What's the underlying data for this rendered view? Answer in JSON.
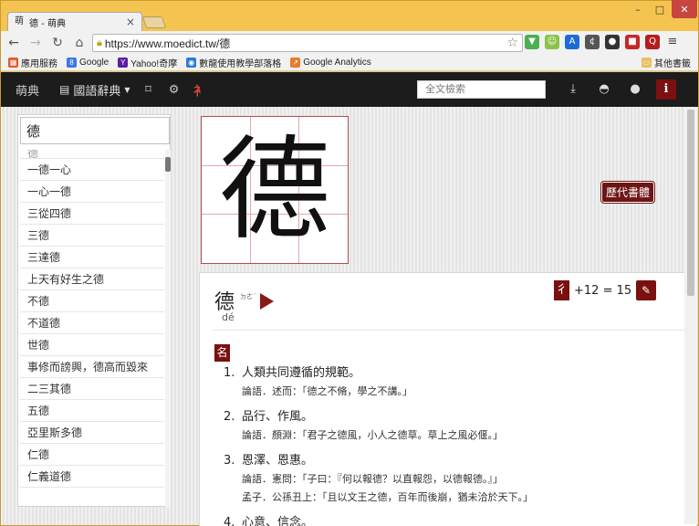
{
  "browser": {
    "tab_title": "德 - 萌典",
    "tab_favicon": "萌",
    "tab_close": "×",
    "url": "https://www.moedict.tw/德",
    "window_controls": {
      "minimize": "–",
      "maximize": "□",
      "close": "✕"
    }
  },
  "bookmarks": [
    {
      "label": "應用服務",
      "icon": "apps-grid-icon",
      "color": "#e05a2a"
    },
    {
      "label": "Google",
      "icon": "google-icon",
      "color": "#3b78e7"
    },
    {
      "label": "Yahoo!奇摩",
      "icon": "yahoo-icon",
      "color": "#5a1fa0"
    },
    {
      "label": "數龍使用教學部落格",
      "icon": "blog-icon",
      "color": "#2a7ad6"
    },
    {
      "label": "Google Analytics",
      "icon": "analytics-icon",
      "color": "#e87b2a"
    }
  ],
  "bookmarks_other": "其他書籤",
  "site": {
    "logo": "萌典",
    "dict_label": "國語辭典",
    "search_placeholder": "全文檢索"
  },
  "sidebar": {
    "query": "德",
    "partial_item": "德",
    "items": [
      "一德一心",
      "一心一德",
      "三從四德",
      "三德",
      "三達德",
      "上天有好生之德",
      "不德",
      "不道德",
      "世德",
      "事修而謗興，德高而毀來",
      "二三其德",
      "五德",
      "亞里斯多德",
      "仁德",
      "仁義道德"
    ]
  },
  "entry": {
    "character": "德",
    "history_button": "歷代書體",
    "headword": "德",
    "bopomofo": "ㄉㄜˊ",
    "pinyin": "dé",
    "radical": "彳",
    "strokes": "+12 = 15",
    "part_of_speech": "名",
    "definitions": [
      {
        "num": "1.",
        "text": "人類共同遵循的規範。",
        "examples": [
          "論語．述而：「德之不脩，學之不講。」"
        ]
      },
      {
        "num": "2.",
        "text": "品行、作風。",
        "examples": [
          "論語．顏淵：「君子之德風，小人之德草。草上之風必偃。」"
        ]
      },
      {
        "num": "3.",
        "text": "恩澤、恩惠。",
        "examples": [
          "論語．憲問：「子曰：『何以報德？以直報怨，以德報德。』」",
          "孟子．公孫丑上：「且以文王之德，百年而後崩，猶未洽於天下。」"
        ]
      },
      {
        "num": "4.",
        "text": "心意、信念。",
        "examples": []
      }
    ]
  },
  "colors": {
    "accent": "#7a1010",
    "header_bg": "#1c1c1c",
    "chrome": "#f5c450"
  }
}
